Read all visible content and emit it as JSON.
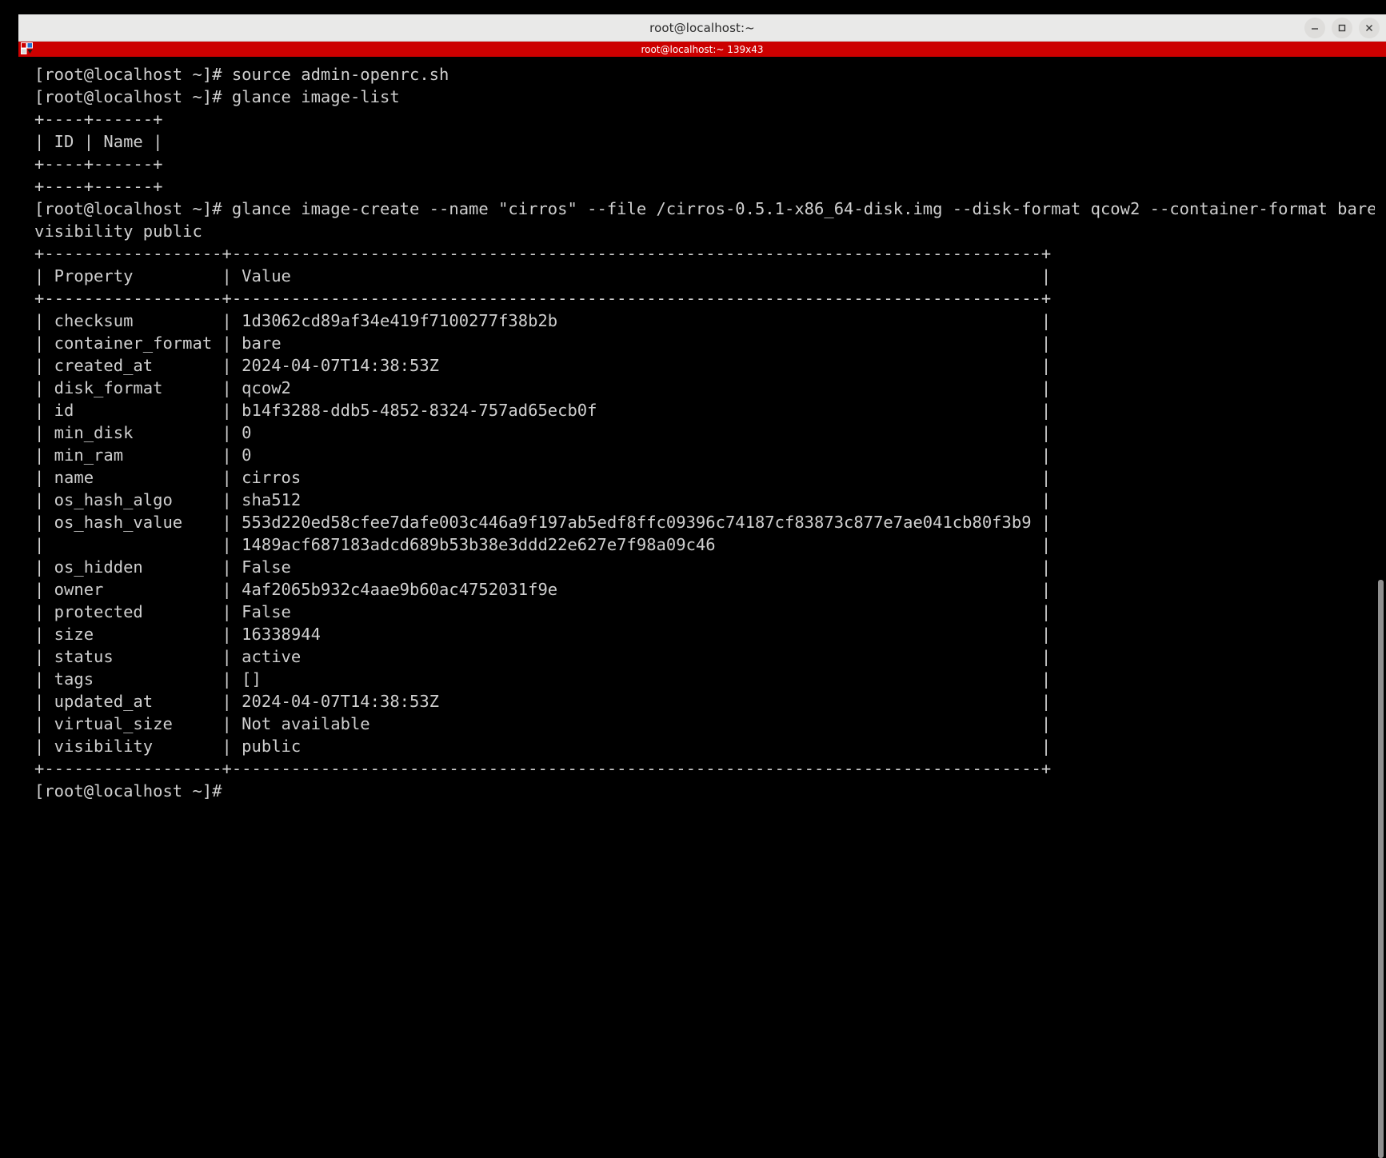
{
  "window": {
    "title": "root@localhost:~",
    "controls": [
      {
        "name": "minimize",
        "glyph": "minimize-icon"
      },
      {
        "name": "maximize",
        "glyph": "maximize-icon"
      },
      {
        "name": "close",
        "glyph": "close-icon"
      }
    ]
  },
  "tabbar": {
    "label": "root@localhost:~ 139x43",
    "background": "#cc0000",
    "menu_icon": "tab-menu-icon"
  },
  "scrollbar": {
    "thumb_top_pct": 47.5,
    "thumb_height_pct": 52.5,
    "thumb_color": "#8f8f8f"
  },
  "terminal": {
    "foreground": "#cfcfcf",
    "background": "#000000",
    "prompt": "[root@localhost ~]#",
    "columns": 139,
    "rows": 43,
    "lines": [
      "[root@localhost ~]# source admin-openrc.sh",
      "[root@localhost ~]# glance image-list",
      "+----+------+",
      "| ID | Name |",
      "+----+------+",
      "+----+------+",
      "[root@localhost ~]# glance image-create --name \"cirros\" --file /cirros-0.5.1-x86_64-disk.img --disk-format qcow2 --container-format bare --",
      "visibility public",
      "+------------------+----------------------------------------------------------------------------------+",
      "| Property         | Value                                                                            |",
      "+------------------+----------------------------------------------------------------------------------+",
      "| checksum         | 1d3062cd89af34e419f7100277f38b2b                                                 |",
      "| container_format | bare                                                                             |",
      "| created_at       | 2024-04-07T14:38:53Z                                                             |",
      "| disk_format      | qcow2                                                                            |",
      "| id               | b14f3288-ddb5-4852-8324-757ad65ecb0f                                             |",
      "| min_disk         | 0                                                                                |",
      "| min_ram          | 0                                                                                |",
      "| name             | cirros                                                                           |",
      "| os_hash_algo     | sha512                                                                           |",
      "| os_hash_value    | 553d220ed58cfee7dafe003c446a9f197ab5edf8ffc09396c74187cf83873c877e7ae041cb80f3b9 |",
      "|                  | 1489acf687183adcd689b53b38e3ddd22e627e7f98a09c46                                 |",
      "| os_hidden        | False                                                                            |",
      "| owner            | 4af2065b932c4aae9b60ac4752031f9e                                                 |",
      "| protected        | False                                                                            |",
      "| size             | 16338944                                                                         |",
      "| status           | active                                                                           |",
      "| tags             | []                                                                               |",
      "| updated_at       | 2024-04-07T14:38:53Z                                                             |",
      "| virtual_size     | Not available                                                                    |",
      "| visibility       | public                                                                           |",
      "+------------------+----------------------------------------------------------------------------------+",
      "[root@localhost ~]#"
    ],
    "commands": [
      "source admin-openrc.sh",
      "glance image-list",
      "glance image-create --name \"cirros\" --file /cirros-0.5.1-x86_64-disk.img --disk-format qcow2 --container-format bare --visibility public"
    ],
    "image_list_table": {
      "headers": [
        "ID",
        "Name"
      ],
      "rows": []
    },
    "image_properties": {
      "headers": [
        "Property",
        "Value"
      ],
      "rows": [
        [
          "checksum",
          "1d3062cd89af34e419f7100277f38b2b"
        ],
        [
          "container_format",
          "bare"
        ],
        [
          "created_at",
          "2024-04-07T14:38:53Z"
        ],
        [
          "disk_format",
          "qcow2"
        ],
        [
          "id",
          "b14f3288-ddb5-4852-8324-757ad65ecb0f"
        ],
        [
          "min_disk",
          "0"
        ],
        [
          "min_ram",
          "0"
        ],
        [
          "name",
          "cirros"
        ],
        [
          "os_hash_algo",
          "sha512"
        ],
        [
          "os_hash_value",
          "553d220ed58cfee7dafe003c446a9f197ab5edf8ffc09396c74187cf83873c877e7ae041cb80f3b91489acf687183adcd689b53b38e3ddd22e627e7f98a09c46"
        ],
        [
          "os_hidden",
          "False"
        ],
        [
          "owner",
          "4af2065b932c4aae9b60ac4752031f9e"
        ],
        [
          "protected",
          "False"
        ],
        [
          "size",
          "16338944"
        ],
        [
          "status",
          "active"
        ],
        [
          "tags",
          "[]"
        ],
        [
          "updated_at",
          "2024-04-07T14:38:53Z"
        ],
        [
          "virtual_size",
          "Not available"
        ],
        [
          "visibility",
          "public"
        ]
      ]
    }
  }
}
